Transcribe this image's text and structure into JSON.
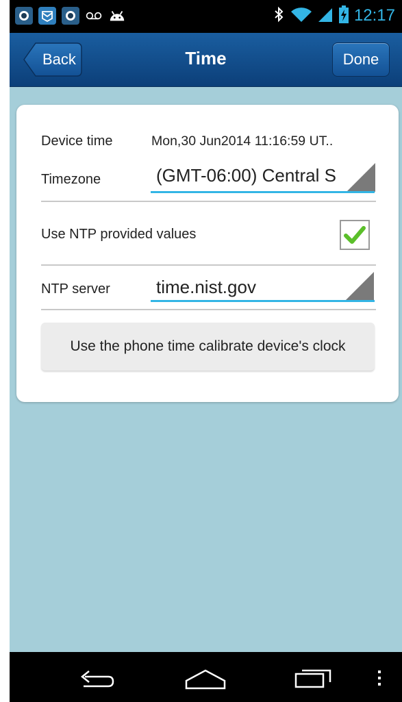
{
  "status_bar": {
    "time": "12:17",
    "left_icons": [
      "app-icon",
      "mail-icon",
      "app-icon",
      "voicemail-icon",
      "android-icon"
    ],
    "right_icons": [
      "bluetooth-icon",
      "wifi-icon",
      "signal-icon",
      "battery-charging-icon"
    ]
  },
  "header": {
    "title": "Time",
    "back_label": "Back",
    "done_label": "Done"
  },
  "form": {
    "device_time_label": "Device time",
    "device_time_value": "Mon,30 Jun2014 11:16:59   UT..",
    "timezone_label": "Timezone",
    "timezone_value": "(GMT-06:00) Central S",
    "ntp_label": "Use NTP provided values",
    "ntp_checked": true,
    "ntp_server_label": "NTP server",
    "ntp_server_value": "time.nist.gov",
    "calibrate_label": "Use the phone time calibrate device's clock"
  },
  "colors": {
    "accent": "#33b5e5",
    "header": "#0c3f79",
    "background": "#a5ced9",
    "check": "#5bbf2a"
  }
}
